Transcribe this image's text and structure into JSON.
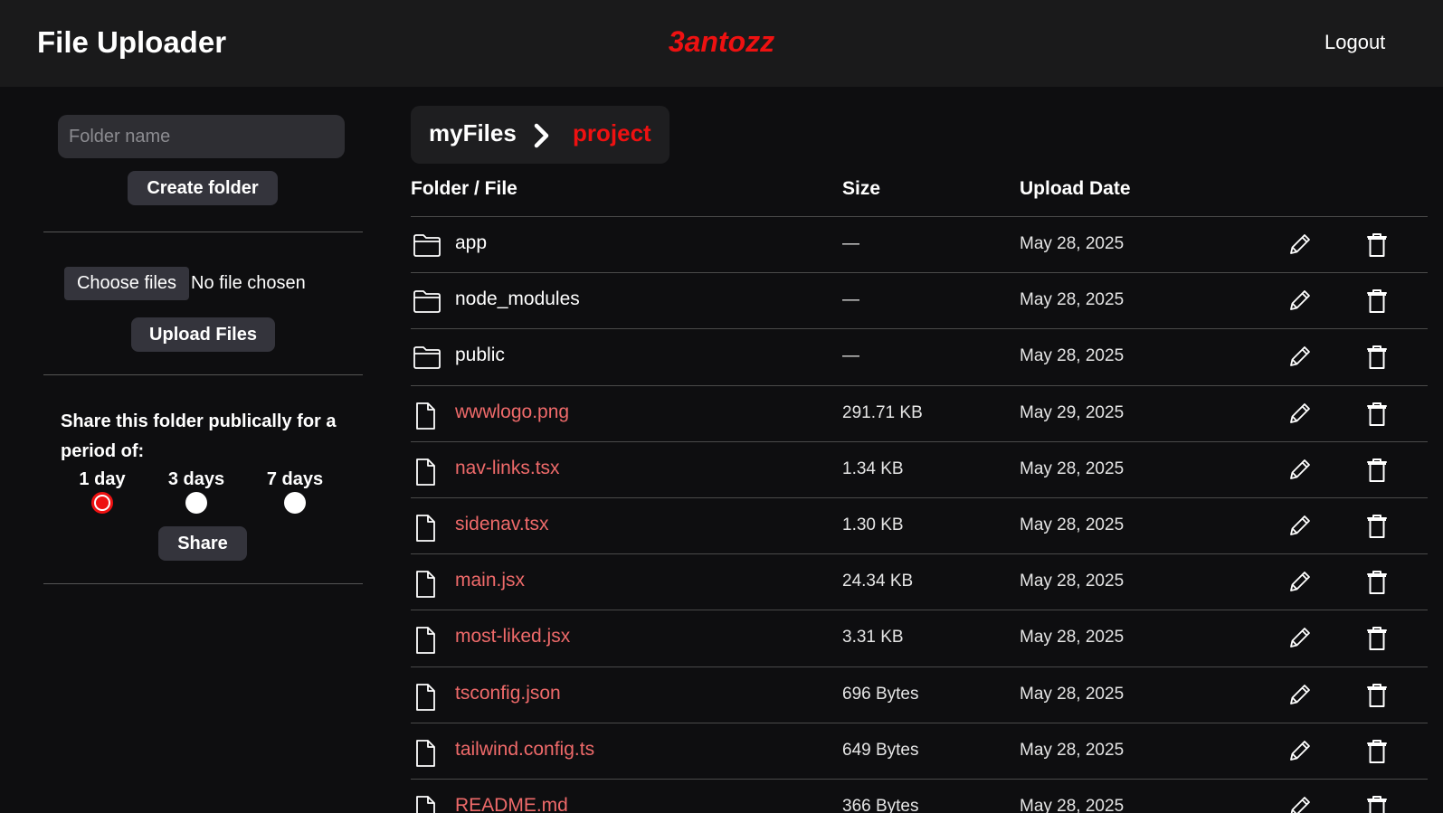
{
  "header": {
    "title": "File Uploader",
    "username": "3antozz",
    "logout_label": "Logout"
  },
  "sidebar": {
    "folder_input_placeholder": "Folder name",
    "create_folder_label": "Create folder",
    "choose_files_label": "Choose files",
    "no_file_text": "No file chosen",
    "upload_label": "Upload Files",
    "share_text": "Share this folder publically for a period of:",
    "share_options": [
      {
        "label": "1 day",
        "checked": true
      },
      {
        "label": "3 days",
        "checked": false
      },
      {
        "label": "7 days",
        "checked": false
      }
    ],
    "share_label": "Share"
  },
  "breadcrumb": {
    "root": "myFiles",
    "current": "project"
  },
  "table": {
    "columns": [
      "Folder / File",
      "Size",
      "Upload Date"
    ],
    "rows": [
      {
        "type": "folder",
        "name": "app",
        "size": "—",
        "date": "May 28, 2025"
      },
      {
        "type": "folder",
        "name": "node_modules",
        "size": "—",
        "date": "May 28, 2025"
      },
      {
        "type": "folder",
        "name": "public",
        "size": "—",
        "date": "May 28, 2025"
      },
      {
        "type": "file",
        "name": "wwwlogo.png",
        "size": "291.71 KB",
        "date": "May 29, 2025"
      },
      {
        "type": "file",
        "name": "nav-links.tsx",
        "size": "1.34 KB",
        "date": "May 28, 2025"
      },
      {
        "type": "file",
        "name": "sidenav.tsx",
        "size": "1.30 KB",
        "date": "May 28, 2025"
      },
      {
        "type": "file",
        "name": "main.jsx",
        "size": "24.34 KB",
        "date": "May 28, 2025"
      },
      {
        "type": "file",
        "name": "most-liked.jsx",
        "size": "3.31 KB",
        "date": "May 28, 2025"
      },
      {
        "type": "file",
        "name": "tsconfig.json",
        "size": "696 Bytes",
        "date": "May 28, 2025"
      },
      {
        "type": "file",
        "name": "tailwind.config.ts",
        "size": "649 Bytes",
        "date": "May 28, 2025"
      },
      {
        "type": "file",
        "name": "README.md",
        "size": "366 Bytes",
        "date": "May 28, 2025"
      }
    ]
  },
  "icons": {
    "folder": "folder-icon",
    "file": "file-icon",
    "edit": "pencil-icon",
    "delete": "trash-icon",
    "separator": "chevron-right-icon"
  },
  "colors": {
    "accent": "#ee1111",
    "file_link": "#ef6a6a",
    "background": "#0e0e10",
    "header_bg": "#1a1a1b"
  }
}
